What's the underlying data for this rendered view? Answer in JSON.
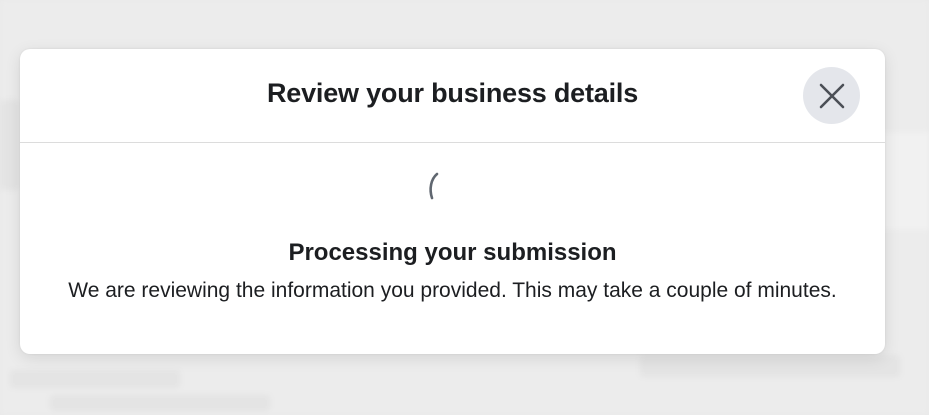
{
  "modal": {
    "title": "Review your business details",
    "close_icon": "close-icon",
    "spinner_icon": "loading-spinner-icon",
    "processing_title": "Processing your submission",
    "processing_message": "We are reviewing the information you provided. This may take a couple of minutes."
  },
  "colors": {
    "text": "#1c1e21",
    "close_button_bg": "#e4e6eb",
    "divider": "#dcdcdc",
    "modal_bg": "#ffffff"
  }
}
